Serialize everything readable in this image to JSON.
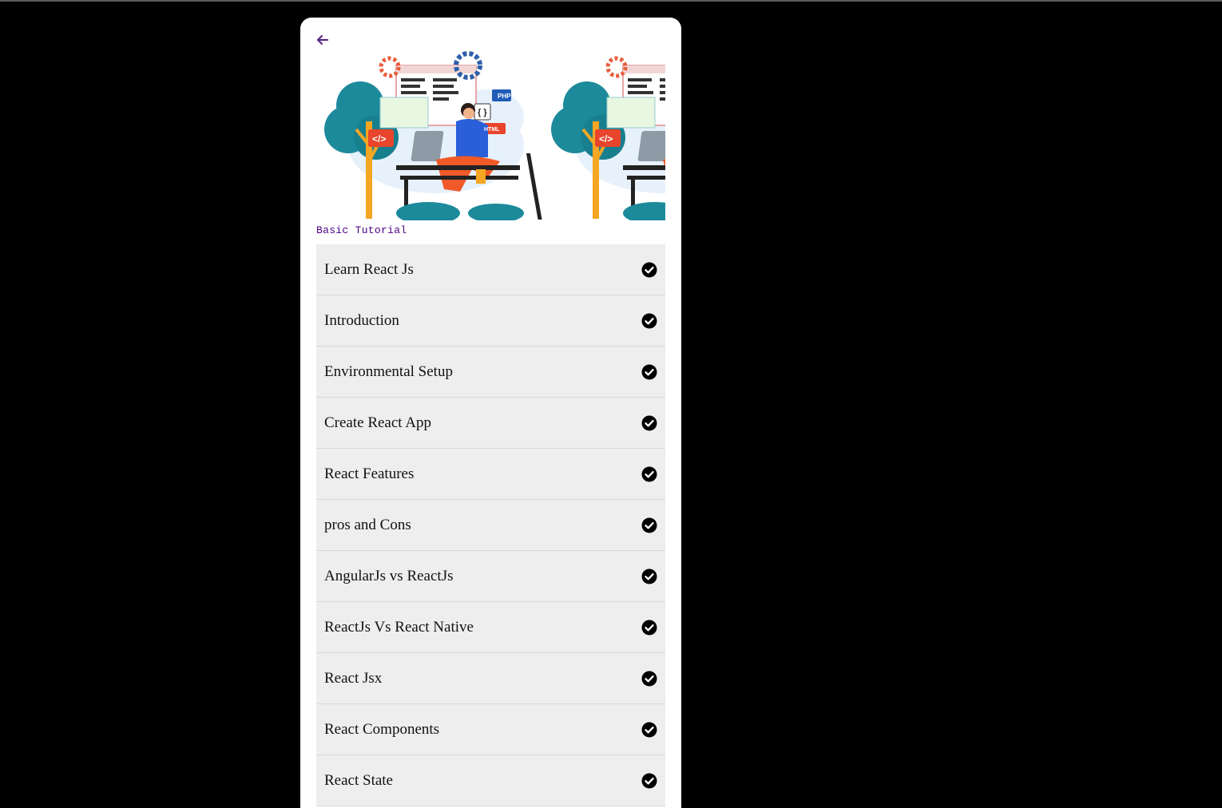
{
  "header": {
    "back_icon": "arrow-left-icon",
    "accent": "#5b2a86"
  },
  "banner": {
    "labels": {
      "php": "PHP",
      "braces": "{ }",
      "html": "HTML",
      "code": "</>"
    }
  },
  "section": {
    "title": "Basic Tutorial"
  },
  "topics": [
    {
      "label": "Learn React Js",
      "icon": "check-circle-icon"
    },
    {
      "label": "Introduction",
      "icon": "check-circle-icon"
    },
    {
      "label": "Environmental Setup",
      "icon": "check-circle-icon"
    },
    {
      "label": "Create React App",
      "icon": "check-circle-icon"
    },
    {
      "label": "React Features",
      "icon": "check-circle-icon"
    },
    {
      "label": "pros and Cons",
      "icon": "check-circle-icon"
    },
    {
      "label": "AngularJs vs ReactJs",
      "icon": "check-circle-icon"
    },
    {
      "label": "ReactJs Vs React Native",
      "icon": "check-circle-icon"
    },
    {
      "label": "React Jsx",
      "icon": "check-circle-icon"
    },
    {
      "label": "React Components",
      "icon": "check-circle-icon"
    },
    {
      "label": "React State",
      "icon": "check-circle-icon"
    }
  ]
}
